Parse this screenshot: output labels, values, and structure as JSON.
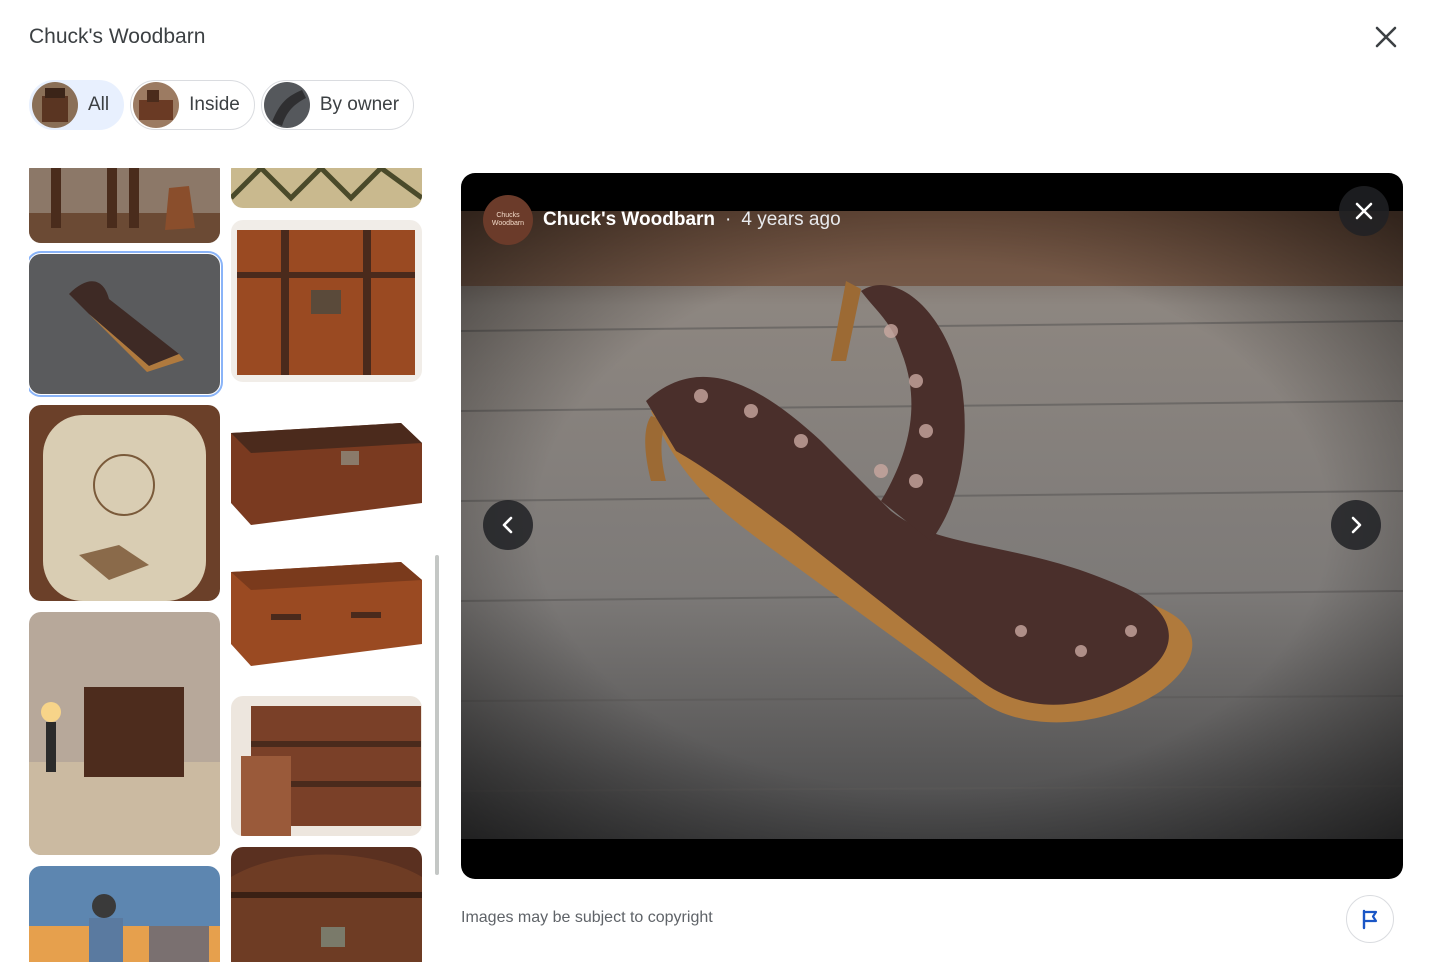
{
  "header": {
    "title": "Chuck's Woodbarn"
  },
  "icons": {
    "close": "close-icon",
    "flag": "flag-icon",
    "prev": "chevron-left-icon",
    "next": "chevron-right-icon"
  },
  "filters": [
    {
      "label": "All",
      "selected": true
    },
    {
      "label": "Inside",
      "selected": false
    },
    {
      "label": "By owner",
      "selected": false
    }
  ],
  "viewer": {
    "author": "Chuck's Woodbarn",
    "separator": "·",
    "age": "4 years ago",
    "avatar_text": "Chucks Woodbarn"
  },
  "footer": {
    "copyright_notice": "Images may be subject to copyright"
  },
  "colors": {
    "selected_chip": "#e8f0fe",
    "selected_outline": "#8ab4f8",
    "text_secondary": "#5f6368"
  }
}
